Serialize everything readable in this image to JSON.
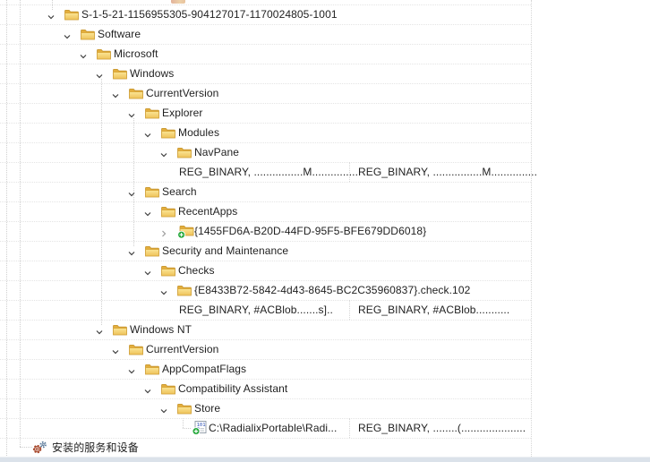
{
  "tree": {
    "rows": [
      {
        "kind": "key",
        "indent": 0,
        "chevron": "down",
        "icon": "folder",
        "label": "S-1-5-21-1156955305-904127017-1170024805-1001"
      },
      {
        "kind": "key",
        "indent": 1,
        "chevron": "down",
        "icon": "folder",
        "label": "Software"
      },
      {
        "kind": "key",
        "indent": 2,
        "chevron": "down",
        "icon": "folder",
        "label": "Microsoft"
      },
      {
        "kind": "key",
        "indent": 3,
        "chevron": "down",
        "icon": "folder",
        "label": "Windows"
      },
      {
        "kind": "key",
        "indent": 4,
        "chevron": "down",
        "icon": "folder",
        "label": "CurrentVersion"
      },
      {
        "kind": "key",
        "indent": 5,
        "chevron": "down",
        "icon": "folder",
        "label": "Explorer"
      },
      {
        "kind": "key",
        "indent": 6,
        "chevron": "down",
        "icon": "folder",
        "label": "Modules"
      },
      {
        "kind": "key",
        "indent": 7,
        "chevron": "down",
        "icon": "folder",
        "label": "NavPane"
      },
      {
        "kind": "values",
        "indent": 8,
        "col1": "REG_BINARY, ................M...............",
        "col2": "REG_BINARY, ................M..............."
      },
      {
        "kind": "key",
        "indent": 5,
        "chevron": "down",
        "icon": "folder",
        "label": "Search"
      },
      {
        "kind": "key",
        "indent": 6,
        "chevron": "down",
        "icon": "folder",
        "label": "RecentApps"
      },
      {
        "kind": "key",
        "indent": 7,
        "chevron": "right",
        "icon": "folder-add",
        "label": "{1455FD6A-B20D-44FD-95F5-BFE679DD6018}"
      },
      {
        "kind": "key",
        "indent": 5,
        "chevron": "down",
        "icon": "folder",
        "label": "Security and Maintenance"
      },
      {
        "kind": "key",
        "indent": 6,
        "chevron": "down",
        "icon": "folder",
        "label": "Checks"
      },
      {
        "kind": "key",
        "indent": 7,
        "chevron": "down",
        "icon": "folder",
        "label": "{E8433B72-5842-4d43-8645-BC2C35960837}.check.102"
      },
      {
        "kind": "values",
        "indent": 8,
        "col1": "REG_BINARY, #ACBlob.......s]..",
        "col2": "REG_BINARY, #ACBlob..........."
      },
      {
        "kind": "key",
        "indent": 3,
        "chevron": "down",
        "icon": "folder",
        "label": "Windows NT"
      },
      {
        "kind": "key",
        "indent": 4,
        "chevron": "down",
        "icon": "folder",
        "label": "CurrentVersion"
      },
      {
        "kind": "key",
        "indent": 5,
        "chevron": "down",
        "icon": "folder",
        "label": "AppCompatFlags"
      },
      {
        "kind": "key",
        "indent": 6,
        "chevron": "down",
        "icon": "folder",
        "label": "Compatibility Assistant"
      },
      {
        "kind": "key",
        "indent": 7,
        "chevron": "down",
        "icon": "folder",
        "label": "Store"
      },
      {
        "kind": "value-named",
        "indent": 8,
        "connector": true,
        "icon": "binary-add",
        "label": "C:\\RadialixPortable\\Radi...",
        "col2": "REG_BINARY, ........(....................."
      },
      {
        "kind": "service",
        "icon": "gear",
        "label": "安装的服务和设备"
      }
    ]
  },
  "colors": {
    "added_badge_green": "#27A93D",
    "folder_yellow": "#EFC35B",
    "gear_red": "#A84B2F",
    "gear_blue": "#5F7E9D",
    "text": "#1f1f1f",
    "grid_line": "#d6d6d6",
    "bottom_bar": "#dbe2ea"
  }
}
